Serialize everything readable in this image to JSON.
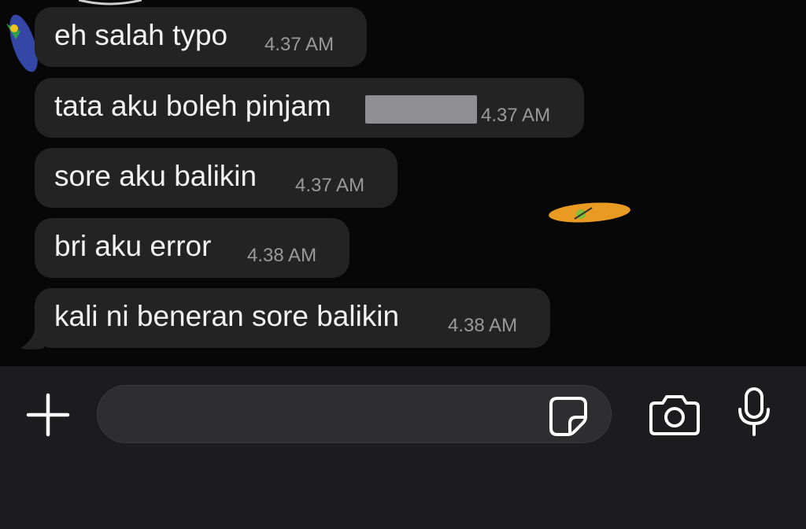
{
  "messages": [
    {
      "text": "eh salah typo",
      "time": "4.37 AM"
    },
    {
      "text": "tata aku boleh pinjam",
      "time": "4.37 AM",
      "redacted": true
    },
    {
      "text": "sore aku balikin",
      "time": "4.37 AM"
    },
    {
      "text": "bri aku error",
      "time": "4.38 AM"
    },
    {
      "text": "kali ni beneran sore balikin",
      "time": "4.38 AM"
    }
  ],
  "composer": {
    "placeholder": "",
    "value": ""
  },
  "icons": {
    "attach": "plus-icon",
    "sticker": "sticker-icon",
    "camera": "camera-icon",
    "microphone": "microphone-icon"
  },
  "colors": {
    "bubble": "#232323",
    "timestamp": "#9a9a9a",
    "composer_bg": "#1c1c1e",
    "input_bg": "#2e2e30"
  }
}
